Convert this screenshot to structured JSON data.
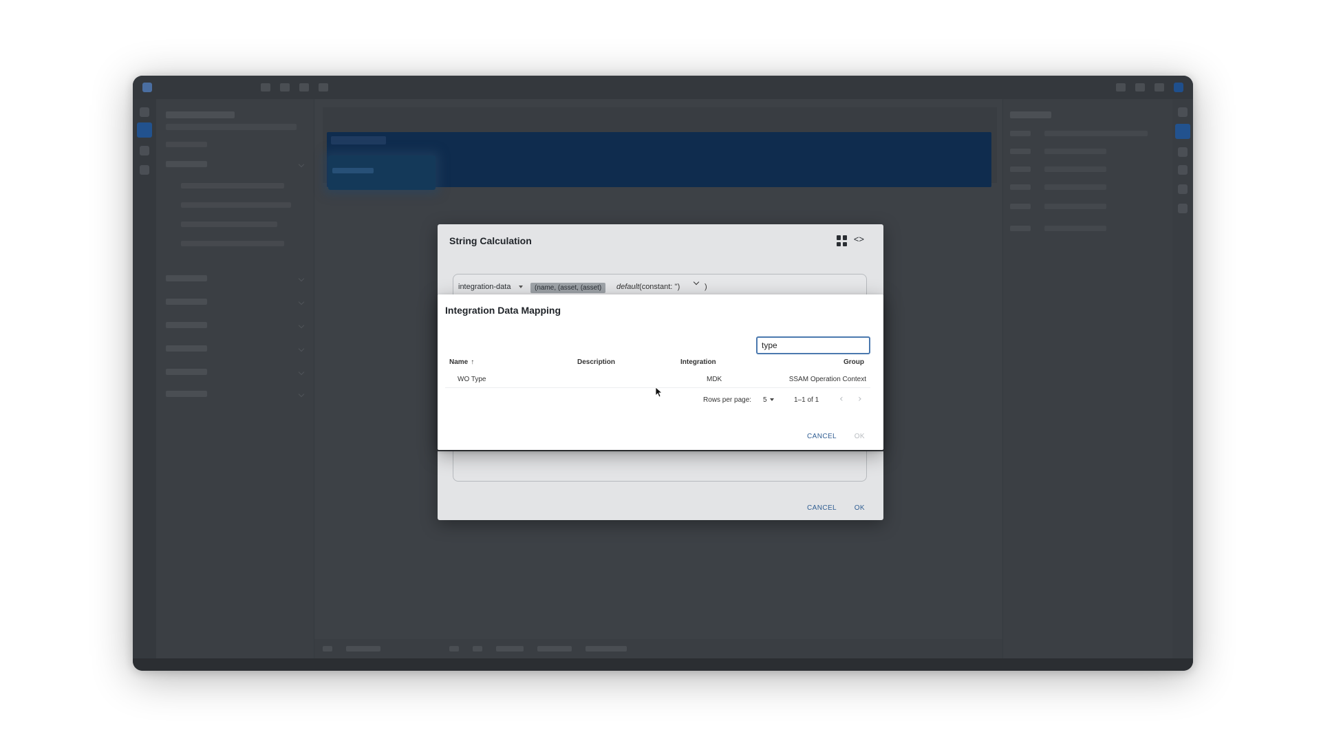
{
  "string_calc": {
    "title": "String Calculation",
    "source_label": "integration-data",
    "selected_token": "(name, (asset, (asset)",
    "default_fn": "default",
    "default_args": "(constant: '')",
    "close_paren": ")",
    "cancel_label": "CANCEL",
    "ok_label": "OK",
    "grid_icon": "grid-view-icon",
    "code_icon": "code-view-icon"
  },
  "mapping_dialog": {
    "title": "Integration Data Mapping",
    "search": {
      "value": "type",
      "placeholder": ""
    },
    "columns": {
      "name": "Name",
      "sort_arrow": "↑",
      "description": "Description",
      "integration": "Integration",
      "group": "Group"
    },
    "rows": [
      {
        "name": "WO Type",
        "description": "",
        "integration": "MDK",
        "group": "SSAM Operation Context"
      }
    ],
    "pagination": {
      "rows_per_page_label": "Rows per page:",
      "rows_per_page": "5",
      "range": "1–1 of 1",
      "prev": "‹",
      "next": "›"
    },
    "cancel_label": "CANCEL",
    "ok_label": "OK"
  },
  "colors": {
    "accent": "#2f5d92",
    "search_border": "#4a78ae",
    "overlay": "#3b3f44"
  }
}
